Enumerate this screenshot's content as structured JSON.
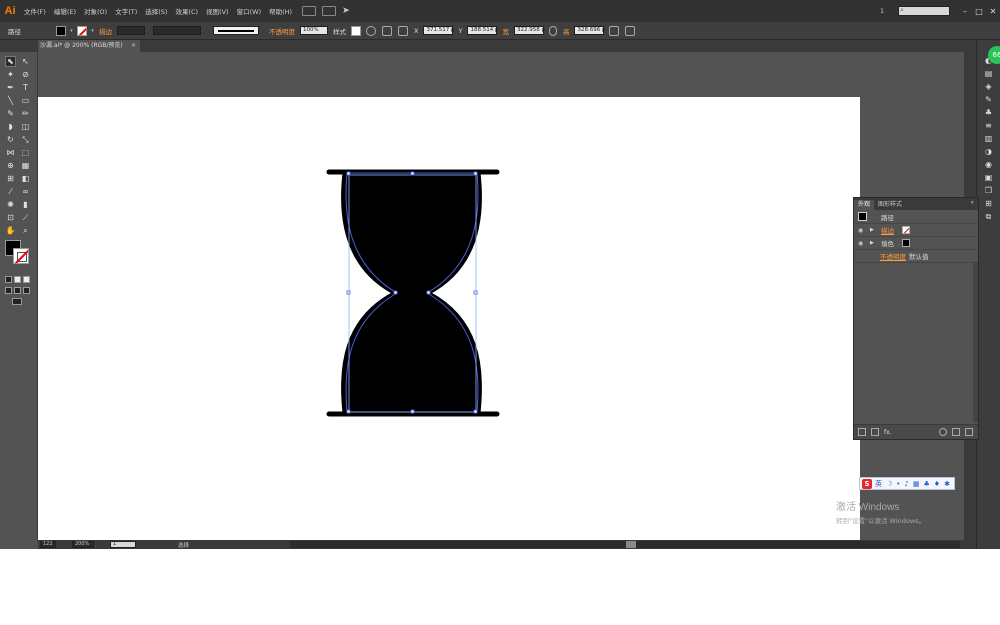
{
  "app": {
    "logo": "Ai",
    "menus": [
      "文件(F)",
      "编辑(E)",
      "对象(O)",
      "文字(T)",
      "选择(S)",
      "效果(C)",
      "视图(V)",
      "窗口(W)",
      "帮助(H)"
    ],
    "workspace": "1",
    "search_icon": "magnifier-icon",
    "window_controls": [
      "–",
      "□",
      "✕"
    ]
  },
  "control_bar": {
    "selection_label": "路径",
    "stroke_label": "描边",
    "stroke_profile": "基本",
    "opacity_label": "不透明度",
    "opacity_value": "100%",
    "style_label": "样式",
    "x_label": "X",
    "x_value": "371.517 p",
    "y_label": "Y",
    "y_value": "188.514 p",
    "w_label": "宽",
    "w_value": "322.958 p",
    "h_label": "高",
    "h_value": "328.696 p"
  },
  "document": {
    "tab_title": "沙漏.ai* @ 200% (RGB/预览)",
    "close": "×"
  },
  "status_bar": {
    "zoom": "200%",
    "artboard": "1",
    "tool": "选择",
    "left_value": "122"
  },
  "appearance_panel": {
    "tabs": [
      "外观",
      "图形样式"
    ],
    "menu": "»",
    "header_label": "路径",
    "rows": [
      {
        "label": "描边",
        "swatch": "none"
      },
      {
        "label": "填色",
        "swatch": "black"
      }
    ],
    "opacity_label": "不透明度",
    "opacity_value": "默认值",
    "footer_fx": "fx."
  },
  "tray": {
    "badge": "66",
    "ime_label": "英"
  },
  "activation": {
    "title": "激活 Windows",
    "subtitle": "转到\"设置\"以激活 Windows。"
  },
  "colors": {
    "accent": "#ff9c3a",
    "path_blue": "#4a5fe0",
    "selection_blue": "#8ab4ff"
  }
}
